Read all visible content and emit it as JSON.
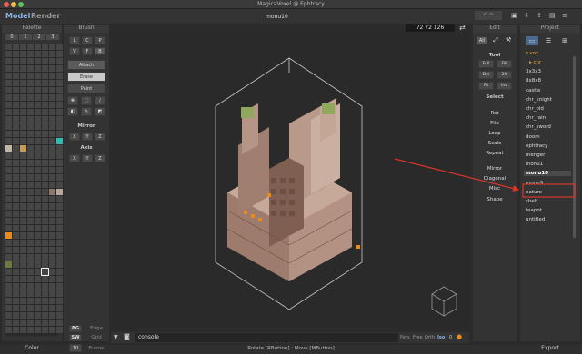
{
  "window": {
    "title": "MagicaVoxel @ Ephtracy"
  },
  "modes": {
    "model": "Model",
    "render": "Render"
  },
  "document": {
    "name": "monu10"
  },
  "sections": {
    "palette": "Palette",
    "brush": "Brush",
    "edit": "Edit",
    "project": "Project"
  },
  "palette": {
    "tabs": [
      "0",
      "1",
      "2",
      "3"
    ],
    "swatches": [
      {
        "index": 111,
        "color": "#33bcb3"
      },
      {
        "index": 112,
        "color": "#bfb6a6"
      },
      {
        "index": 114,
        "color": "#c89a5a"
      },
      {
        "index": 166,
        "color": "#8e7a6a"
      },
      {
        "index": 167,
        "color": "#b9a799"
      },
      {
        "index": 208,
        "color": "#e88a1c"
      },
      {
        "index": 240,
        "color": "#6f7a3f"
      }
    ],
    "selected_index": 253,
    "footer": "Color"
  },
  "brush": {
    "types": [
      "L",
      "C",
      "P",
      "V",
      "F",
      "B"
    ],
    "actions": [
      "Attach",
      "Erase",
      "Paint"
    ],
    "tool_icons": [
      "move-icon",
      "select-icon",
      "pipette-icon",
      "bucket-icon",
      "pencil-icon",
      "line-icon"
    ],
    "mirror_label": "Mirror",
    "mirror_axes": [
      "X",
      "Y",
      "Z"
    ],
    "axis_label": "Axis",
    "axis_axes": [
      "X",
      "Y",
      "Z"
    ],
    "bottom": {
      "bg": "BG",
      "edge": "Edge",
      "sw": "SW",
      "grid": "Grid",
      "frame_num": "10",
      "frame": "Frame"
    }
  },
  "viewport": {
    "coords": "72 72 126",
    "console_placeholder": "console"
  },
  "view_modes": [
    "Pers",
    "Free",
    "Orth",
    "Iso"
  ],
  "view_number": "0",
  "status": "Rotate [RButton] : Move [MButton]",
  "edit": {
    "top_buttons": [
      "All"
    ],
    "tool_label": "Tool",
    "tool_buttons": [
      "Full",
      "Fill",
      "Del",
      "2X",
      "Fit",
      "Inv"
    ],
    "select": "Select",
    "ops": [
      "Rot",
      "Flip",
      "Loop",
      "Scale",
      "Repeat"
    ],
    "ops2": [
      "Mirror",
      "Diagonal",
      "Misc",
      "Shape"
    ]
  },
  "project": {
    "folder": "vox",
    "items": [
      "chr",
      "3x3x3",
      "8x8x8",
      "castle",
      "chr_knight",
      "chr_old",
      "chr_rain",
      "chr_sword",
      "doom",
      "ephtracy",
      "menger",
      "monu1",
      "monu10",
      "monu9",
      "nature",
      "shelf",
      "teapot",
      "untitled"
    ],
    "selected": "monu10",
    "footer": "Export"
  },
  "annotation": {
    "color": "#d9352b"
  }
}
